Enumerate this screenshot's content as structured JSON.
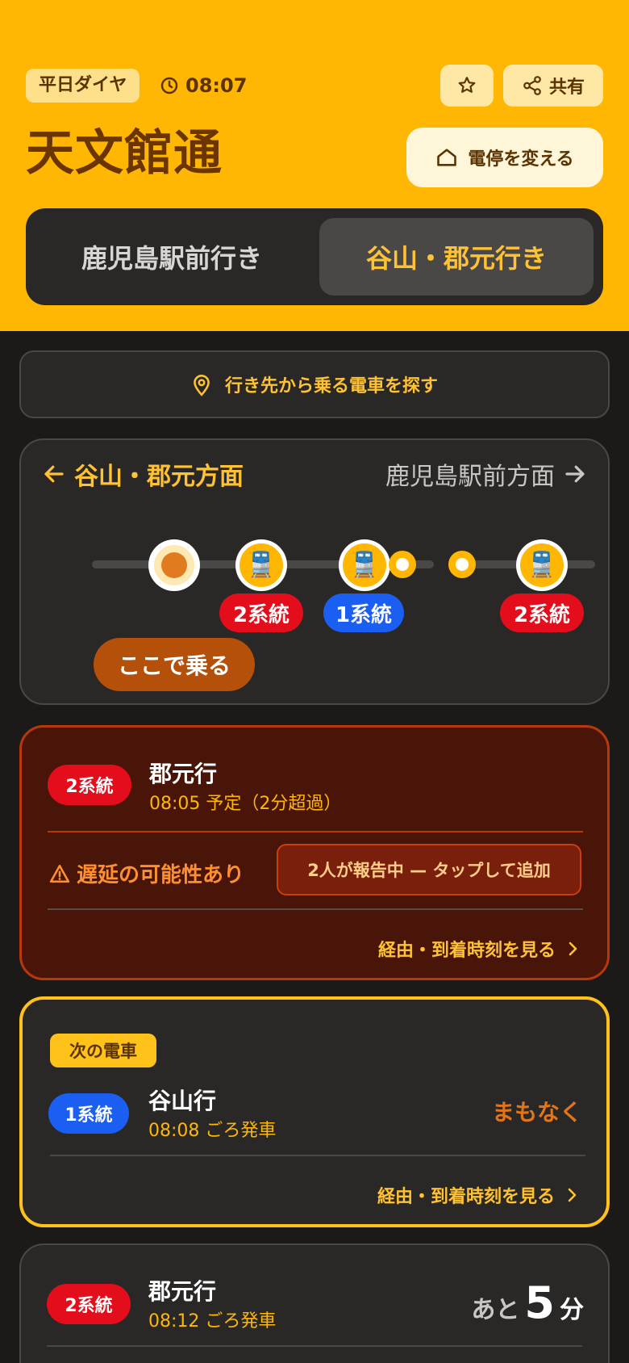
{
  "header": {
    "schedule_label": "平日ダイヤ",
    "time": "08:07",
    "share_label": "共有",
    "title": "天文館通",
    "change_stop_label": "電停を変える",
    "dir_left": "鹿児島駅前行き",
    "dir_right": "谷山・郡元行き"
  },
  "find_button_label": "行き先から乗る電車を探す",
  "map": {
    "left_label": "谷山・郡元方面",
    "right_label": "鹿児島駅前方面",
    "trains": [
      {
        "line": "2系統",
        "color": "red"
      },
      {
        "line": "1系統",
        "color": "blue"
      },
      {
        "line": "2系統",
        "color": "red"
      }
    ],
    "board_label": "ここで乗る"
  },
  "cards": [
    {
      "line": "2系統",
      "dest": "郡元行",
      "schedule": "08:05 予定（2分超過）",
      "warning": "遅延の可能性あり",
      "report": "2人が報告中 — タップして追加",
      "details": "経由・到着時刻を見る"
    },
    {
      "badge": "次の電車",
      "line": "1系統",
      "dest": "谷山行",
      "schedule": "08:08 ごろ発車",
      "status": "まもなく",
      "details": "経由・到着時刻を見る"
    },
    {
      "line": "2系統",
      "dest": "郡元行",
      "schedule": "08:12 ごろ発車",
      "remain_pre": "あと",
      "remain_num": "5",
      "remain_suf": "分"
    }
  ],
  "colors": {
    "accent": "#ffb703",
    "line2": "#e30d1b",
    "line1": "#1b5ef2",
    "delay_bg": "#481508"
  }
}
